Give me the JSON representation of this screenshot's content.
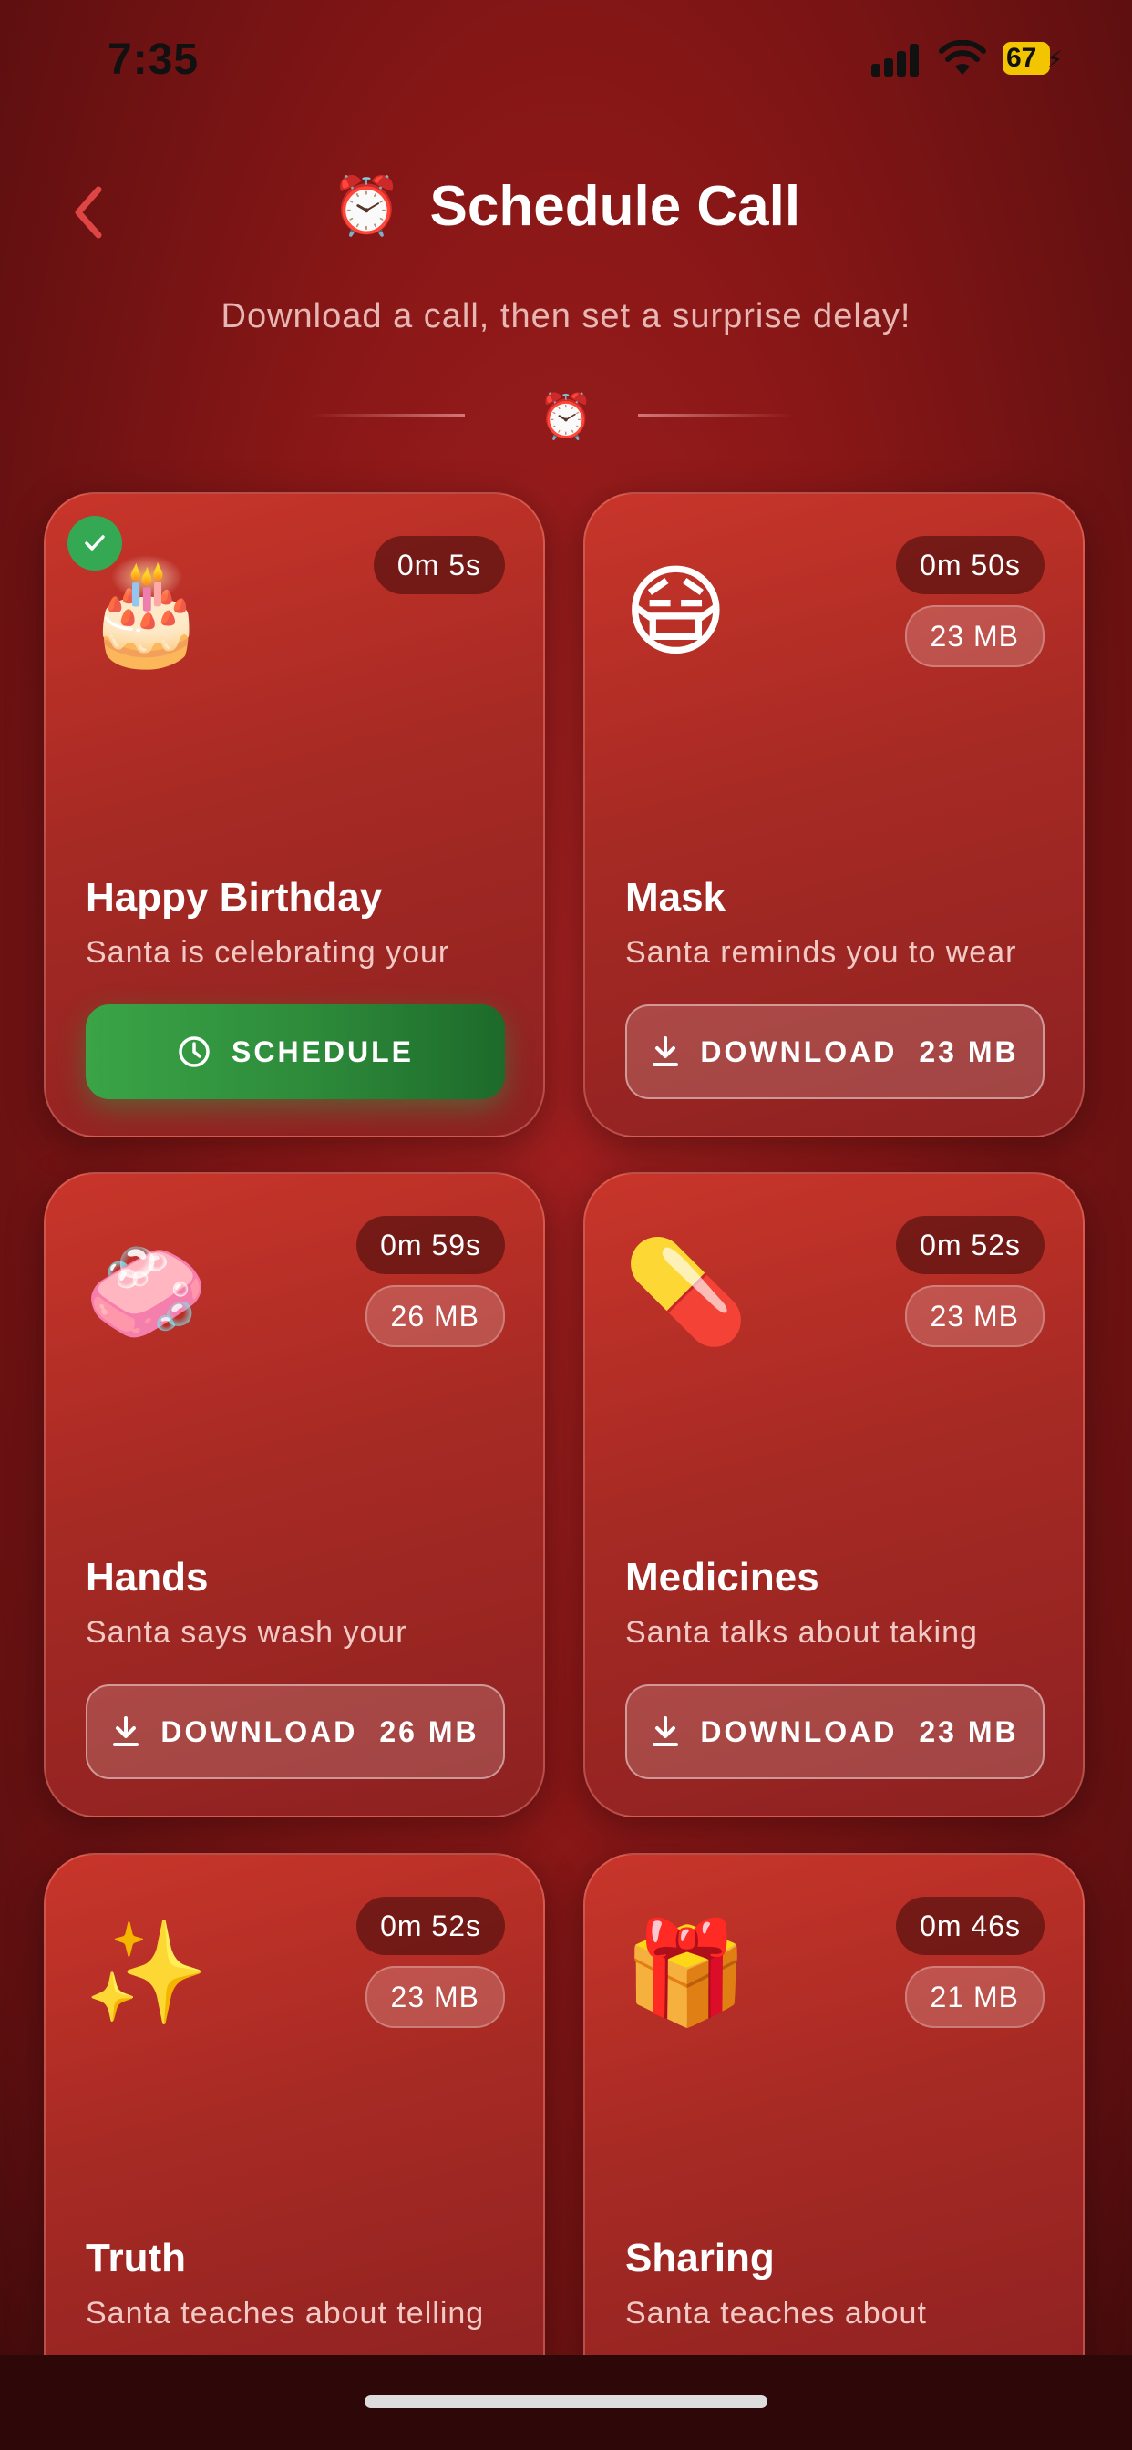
{
  "status": {
    "time": "7:35",
    "battery": "67"
  },
  "header": {
    "title": "Schedule Call",
    "title_emoji": "⏰",
    "subtitle": "Download a call, then set a surprise delay!",
    "divider_emoji": "⏰"
  },
  "colors": {
    "accent_green": "#2d8a3a",
    "card_red": "#b52e27",
    "back_arrow": "#e04040"
  },
  "cards": [
    {
      "emoji": "🎂",
      "name": "Happy Birthday",
      "desc": "Santa is celebrating your",
      "duration": "0m 5s",
      "downloaded": true,
      "button": "SCHEDULE",
      "icon": "clock-icon"
    },
    {
      "emoji": "😷",
      "name": "Mask",
      "desc": "Santa reminds you to wear",
      "duration": "0m 50s",
      "size": "23 MB",
      "button": "DOWNLOAD",
      "button_size": "23 MB",
      "icon": "download-icon"
    },
    {
      "emoji": "🧼",
      "name": "Hands",
      "desc": "Santa says wash your",
      "duration": "0m 59s",
      "size": "26 MB",
      "button": "DOWNLOAD",
      "button_size": "26 MB",
      "icon": "download-icon"
    },
    {
      "emoji": "💊",
      "name": "Medicines",
      "desc": "Santa talks about taking",
      "duration": "0m 52s",
      "size": "23 MB",
      "button": "DOWNLOAD",
      "button_size": "23 MB",
      "icon": "download-icon"
    },
    {
      "emoji": "✨",
      "name": "Truth",
      "desc": "Santa teaches about telling",
      "duration": "0m 52s",
      "size": "23 MB"
    },
    {
      "emoji": "🎁",
      "name": "Sharing",
      "desc": "Santa teaches about",
      "duration": "0m 46s",
      "size": "21 MB"
    }
  ]
}
